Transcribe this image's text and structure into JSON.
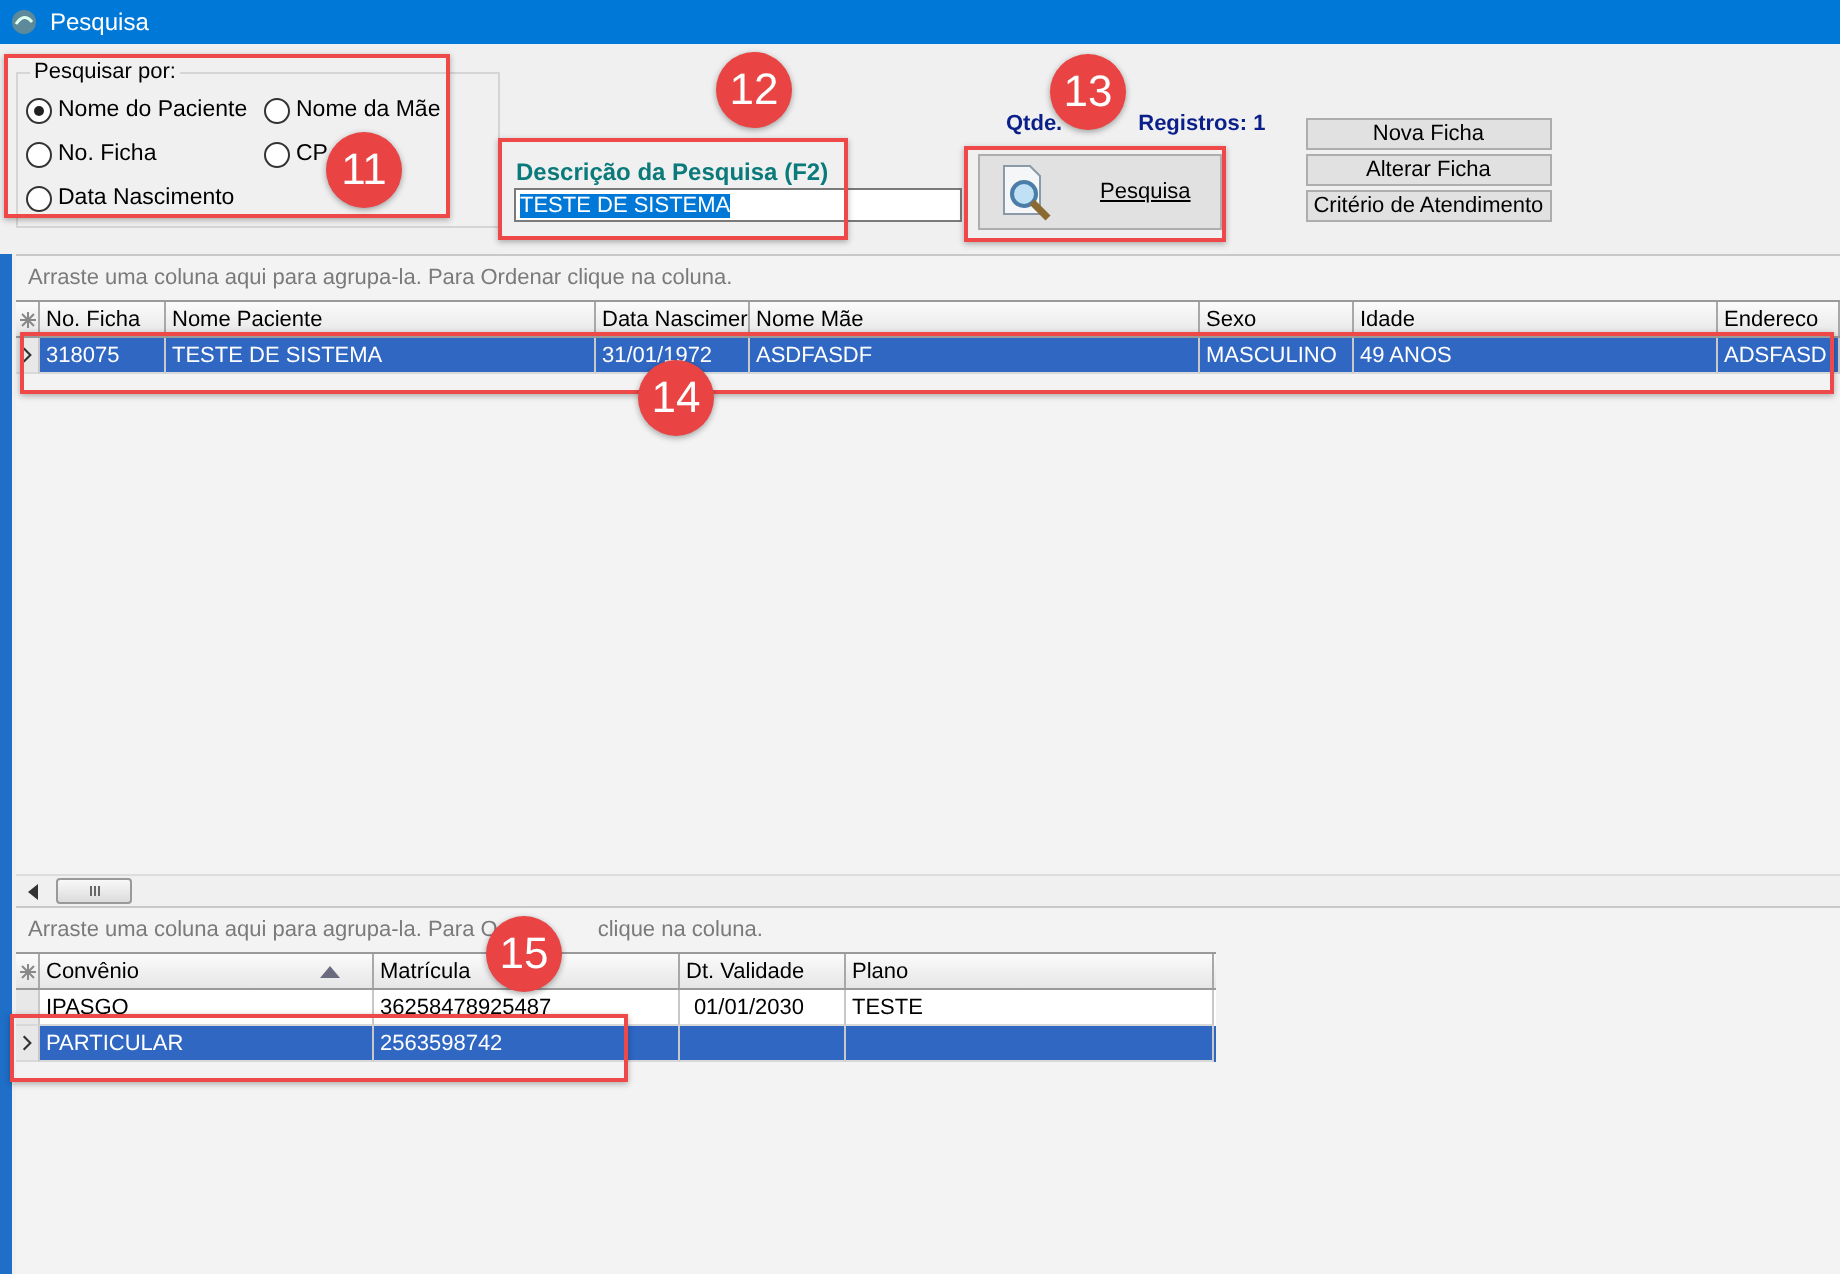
{
  "window": {
    "title": "Pesquisa"
  },
  "search_by": {
    "legend": "Pesquisar por:",
    "options": [
      {
        "label": "Nome do Paciente",
        "selected": true
      },
      {
        "label": "Nome da Mãe",
        "selected": false
      },
      {
        "label": "No. Ficha",
        "selected": false
      },
      {
        "label": "CP",
        "selected": false
      },
      {
        "label": "Data Nascimento",
        "selected": false
      }
    ]
  },
  "search": {
    "label": "Descrição da Pesquisa (F2)",
    "value": "TESTE DE SISTEMA"
  },
  "record_count": {
    "label_start": "Qtde.",
    "label_end": "Registros: 1"
  },
  "search_button": "Pesquisa",
  "side_buttons": [
    "Nova Ficha",
    "Alterar Ficha",
    "Critério de Atendimento"
  ],
  "patients_grid": {
    "group_hint": [
      "Arraste uma coluna aqui para agrupa-la. Para Ordenar clique na coluna."
    ],
    "columns": [
      {
        "label": "No. Ficha",
        "sorted_ascending": false
      },
      {
        "label": "Nome Paciente",
        "sorted_ascending": false
      },
      {
        "label": "Data Nascimer",
        "sorted_ascending": false
      },
      {
        "label": "Nome Mãe",
        "sorted_ascending": false
      },
      {
        "label": "Sexo",
        "sorted_ascending": false
      },
      {
        "label": "Idade",
        "sorted_ascending": false
      },
      {
        "label": "Endereco",
        "sorted_ascending": false
      }
    ],
    "rows": [
      {
        "cells": [
          "318075",
          "TESTE DE SISTEMA",
          "31/01/1972",
          "ASDFASDF",
          "MASCULINO",
          "49 ANOS",
          "ADSFASD"
        ],
        "selected": true
      }
    ]
  },
  "plans_grid": {
    "group_hint": [
      "Arraste uma coluna aqui para agrupa-la. Para O",
      "clique na coluna."
    ],
    "columns": [
      {
        "label": "Convênio",
        "sorted_ascending": true
      },
      {
        "label": "Matrícula",
        "sorted_ascending": false
      },
      {
        "label": "Dt. Validade",
        "sorted_ascending": false
      },
      {
        "label": "Plano",
        "sorted_ascending": false
      }
    ],
    "rows": [
      {
        "cells": [
          "IPASGO",
          "36258478925487",
          "01/01/2030",
          "TESTE"
        ],
        "selected": false
      },
      {
        "cells": [
          "PARTICULAR",
          "2563598742",
          "",
          ""
        ],
        "selected": true
      }
    ]
  },
  "annotations": [
    {
      "number": "11"
    },
    {
      "number": "12"
    },
    {
      "number": "13"
    },
    {
      "number": "14"
    },
    {
      "number": "15"
    }
  ]
}
